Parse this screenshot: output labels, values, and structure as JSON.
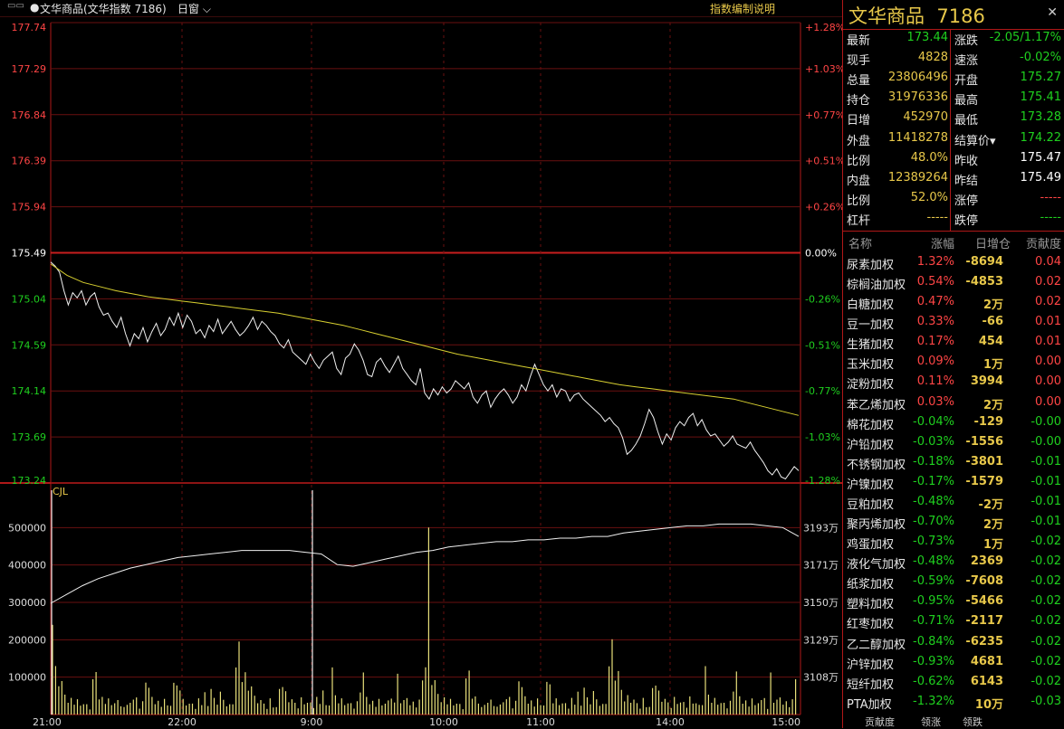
{
  "topbar": {
    "title": "文华商品(文华指数 7186)",
    "period": "日窗",
    "help": "指数编制说明"
  },
  "header": {
    "name": "文华商品",
    "code": "7186"
  },
  "quote_left": [
    {
      "label": "最新",
      "value": "173.44",
      "color": "grn"
    },
    {
      "label": "现手",
      "value": "4828",
      "color": "yel"
    },
    {
      "label": "总量",
      "value": "23806496",
      "color": "yel"
    },
    {
      "label": "持仓",
      "value": "31976336",
      "color": "yel"
    },
    {
      "label": "日增",
      "value": "452970",
      "color": "yel"
    },
    {
      "label": "外盘",
      "value": "11418278",
      "color": "yel"
    },
    {
      "label": "比例",
      "value": "48.0%",
      "color": "yel"
    },
    {
      "label": "内盘",
      "value": "12389264",
      "color": "yel"
    },
    {
      "label": "比例",
      "value": "52.0%",
      "color": "yel"
    },
    {
      "label": "杠杆",
      "value": "-----",
      "color": "yel"
    }
  ],
  "quote_right": [
    {
      "label": "涨跌",
      "value": "-2.05/1.17%",
      "color": "grn"
    },
    {
      "label": "速涨",
      "value": "-0.02%",
      "color": "grn"
    },
    {
      "label": "开盘",
      "value": "175.27",
      "color": "grn"
    },
    {
      "label": "最高",
      "value": "175.41",
      "color": "grn"
    },
    {
      "label": "最低",
      "value": "173.28",
      "color": "grn"
    },
    {
      "label": "结算价▾",
      "value": "174.22",
      "color": "grn"
    },
    {
      "label": "昨收",
      "value": "175.47",
      "color": "wht"
    },
    {
      "label": "昨结",
      "value": "175.49",
      "color": "wht"
    },
    {
      "label": "涨停",
      "value": "-----",
      "color": "red"
    },
    {
      "label": "跌停",
      "value": "-----",
      "color": "grn"
    }
  ],
  "table": {
    "headers": [
      "名称",
      "涨幅",
      "日增仓",
      "贡献度"
    ],
    "rows": [
      {
        "name": "尿素加权",
        "chg": "1.32%",
        "pos": "-8694",
        "contrib": "0.04",
        "chgColor": "red",
        "ctbColor": "red"
      },
      {
        "name": "棕榈油加权",
        "chg": "0.54%",
        "pos": "-4853",
        "contrib": "0.02",
        "chgColor": "red",
        "ctbColor": "red"
      },
      {
        "name": "白糖加权",
        "chg": "0.47%",
        "pos": "2万",
        "contrib": "0.02",
        "chgColor": "red",
        "ctbColor": "red"
      },
      {
        "name": "豆一加权",
        "chg": "0.33%",
        "pos": "-66",
        "contrib": "0.01",
        "chgColor": "red",
        "ctbColor": "red"
      },
      {
        "name": "生猪加权",
        "chg": "0.17%",
        "pos": "454",
        "contrib": "0.01",
        "chgColor": "red",
        "ctbColor": "red"
      },
      {
        "name": "玉米加权",
        "chg": "0.09%",
        "pos": "1万",
        "contrib": "0.00",
        "chgColor": "red",
        "ctbColor": "red"
      },
      {
        "name": "淀粉加权",
        "chg": "0.11%",
        "pos": "3994",
        "contrib": "0.00",
        "chgColor": "red",
        "ctbColor": "red"
      },
      {
        "name": "苯乙烯加权",
        "chg": "0.03%",
        "pos": "2万",
        "contrib": "0.00",
        "chgColor": "red",
        "ctbColor": "red"
      },
      {
        "name": "棉花加权",
        "chg": "-0.04%",
        "pos": "-129",
        "contrib": "-0.00",
        "chgColor": "grn",
        "ctbColor": "grn"
      },
      {
        "name": "沪铅加权",
        "chg": "-0.03%",
        "pos": "-1556",
        "contrib": "-0.00",
        "chgColor": "grn",
        "ctbColor": "grn"
      },
      {
        "name": "不锈钢加权",
        "chg": "-0.18%",
        "pos": "-3801",
        "contrib": "-0.01",
        "chgColor": "grn",
        "ctbColor": "grn"
      },
      {
        "name": "沪镍加权",
        "chg": "-0.17%",
        "pos": "-1579",
        "contrib": "-0.01",
        "chgColor": "grn",
        "ctbColor": "grn"
      },
      {
        "name": "豆粕加权",
        "chg": "-0.48%",
        "pos": "-2万",
        "contrib": "-0.01",
        "chgColor": "grn",
        "ctbColor": "grn"
      },
      {
        "name": "聚丙烯加权",
        "chg": "-0.70%",
        "pos": "2万",
        "contrib": "-0.01",
        "chgColor": "grn",
        "ctbColor": "grn"
      },
      {
        "name": "鸡蛋加权",
        "chg": "-0.73%",
        "pos": "1万",
        "contrib": "-0.02",
        "chgColor": "grn",
        "ctbColor": "grn"
      },
      {
        "name": "液化气加权",
        "chg": "-0.48%",
        "pos": "2369",
        "contrib": "-0.02",
        "chgColor": "grn",
        "ctbColor": "grn"
      },
      {
        "name": "纸浆加权",
        "chg": "-0.59%",
        "pos": "-7608",
        "contrib": "-0.02",
        "chgColor": "grn",
        "ctbColor": "grn"
      },
      {
        "name": "塑料加权",
        "chg": "-0.95%",
        "pos": "-5466",
        "contrib": "-0.02",
        "chgColor": "grn",
        "ctbColor": "grn"
      },
      {
        "name": "红枣加权",
        "chg": "-0.71%",
        "pos": "-2117",
        "contrib": "-0.02",
        "chgColor": "grn",
        "ctbColor": "grn"
      },
      {
        "name": "乙二醇加权",
        "chg": "-0.84%",
        "pos": "-6235",
        "contrib": "-0.02",
        "chgColor": "grn",
        "ctbColor": "grn"
      },
      {
        "name": "沪锌加权",
        "chg": "-0.93%",
        "pos": "4681",
        "contrib": "-0.02",
        "chgColor": "grn",
        "ctbColor": "grn"
      },
      {
        "name": "短纤加权",
        "chg": "-0.62%",
        "pos": "6143",
        "contrib": "-0.02",
        "chgColor": "grn",
        "ctbColor": "grn"
      },
      {
        "name": "PTA加权",
        "chg": "-1.32%",
        "pos": "10万",
        "contrib": "-0.03",
        "chgColor": "grn",
        "ctbColor": "grn"
      }
    ]
  },
  "bottom_tabs": [
    "贡献度",
    "领涨",
    "领跌"
  ],
  "chart_data": {
    "type": "line",
    "price_panel": {
      "y_ticks": [
        177.74,
        177.29,
        176.84,
        176.39,
        175.94,
        175.49,
        175.04,
        174.59,
        174.14,
        173.69,
        173.24
      ],
      "pct_ticks": [
        "+1.28%",
        "+1.03%",
        "+0.77%",
        "+0.51%",
        "+0.26%",
        "0.00%",
        "-0.26%",
        "-0.51%",
        "-0.77%",
        "-1.03%",
        "-1.28%"
      ],
      "ylim": [
        173.24,
        177.74
      ],
      "prev_settle": 175.49,
      "series": [
        {
          "values": [
            175.4,
            175.36,
            175.3,
            175.12,
            174.98,
            175.1,
            175.05,
            175.12,
            174.98,
            175.06,
            175.1,
            174.96,
            174.88,
            174.9,
            174.82,
            174.76,
            174.86,
            174.7,
            174.58,
            174.7,
            174.65,
            174.76,
            174.62,
            174.72,
            174.8,
            174.68,
            174.74,
            174.86,
            174.78,
            174.9,
            174.76,
            174.88,
            174.82,
            174.7,
            174.74,
            174.66,
            174.78,
            174.72,
            174.84,
            174.7,
            174.76,
            174.82,
            174.74,
            174.68,
            174.72,
            174.78,
            174.86,
            174.74,
            174.82,
            174.78,
            174.72,
            174.68,
            174.6,
            174.56,
            174.64,
            174.52,
            174.48,
            174.44,
            174.4,
            174.5,
            174.42,
            174.36,
            174.44,
            174.48,
            174.52,
            174.36,
            174.3,
            174.46,
            174.5,
            174.6,
            174.54,
            174.44,
            174.3,
            174.28,
            174.42,
            174.46,
            174.38,
            174.32,
            174.4,
            174.48,
            174.36,
            174.3,
            174.24,
            174.2,
            174.36,
            174.12,
            174.06,
            174.16,
            174.1,
            174.18,
            174.12,
            174.16,
            174.24,
            174.2,
            174.16,
            174.22,
            174.08,
            174.02,
            174.1,
            174.14,
            173.98,
            174.06,
            174.12,
            174.16,
            174.1,
            174.02,
            174.08,
            174.2,
            174.14,
            174.28,
            174.4,
            174.3,
            174.2,
            174.14,
            174.2,
            174.08,
            174.16,
            174.14,
            174.04,
            174.1,
            174.12,
            174.06,
            174.02,
            173.98,
            173.94,
            173.9,
            173.84,
            173.88,
            173.82,
            173.78,
            173.68,
            173.52,
            173.56,
            173.62,
            173.7,
            173.82,
            173.96,
            173.88,
            173.74,
            173.62,
            173.72,
            173.66,
            173.78,
            173.84,
            173.8,
            173.88,
            173.92,
            173.8,
            173.86,
            173.76,
            173.7,
            173.72,
            173.66,
            173.6,
            173.64,
            173.7,
            173.62,
            173.6,
            173.58,
            173.64,
            173.56,
            173.5,
            173.44,
            173.36,
            173.32,
            173.38,
            173.3,
            173.28,
            173.34,
            173.4,
            173.36
          ]
        },
        {
          "values": [
            175.38,
            175.27,
            175.2,
            175.16,
            175.12,
            175.09,
            175.06,
            175.04,
            175.02,
            175.0,
            174.98,
            174.96,
            174.94,
            174.92,
            174.9,
            174.87,
            174.84,
            174.81,
            174.78,
            174.74,
            174.7,
            174.66,
            174.62,
            174.58,
            174.54,
            174.5,
            174.47,
            174.44,
            174.41,
            174.38,
            174.35,
            174.32,
            174.29,
            174.26,
            174.23,
            174.2,
            174.18,
            174.16,
            174.14,
            174.12,
            174.1,
            174.08,
            174.06,
            174.02,
            173.98,
            173.94,
            173.9
          ]
        }
      ]
    },
    "volume_panel": {
      "label": "CJL",
      "y_ticks": [
        "500000",
        "400000",
        "300000",
        "200000",
        "100000"
      ],
      "ylim": [
        0,
        600000
      ],
      "right_ticks": [
        "3193万",
        "3171万",
        "3150万",
        "3129万",
        "3108万"
      ],
      "oi_curve": [
        3150,
        3155,
        3160,
        3164,
        3167,
        3170,
        3172,
        3174,
        3176,
        3177,
        3178,
        3179,
        3180,
        3180,
        3180,
        3180,
        3179,
        3178,
        3172,
        3171,
        3173,
        3175,
        3177,
        3179,
        3180,
        3182,
        3183,
        3184,
        3185,
        3185,
        3186,
        3186,
        3187,
        3187,
        3188,
        3188,
        3190,
        3191,
        3192,
        3193,
        3194,
        3194,
        3195,
        3195,
        3195,
        3194,
        3193,
        3188
      ],
      "volume_sample": [
        240000,
        150000,
        120000,
        90000,
        70000,
        60000,
        50000,
        40000,
        40000,
        30000,
        50000,
        30000,
        20000,
        90000,
        140000,
        70000,
        50000,
        40000,
        40000,
        30000,
        50000,
        40000,
        30000,
        40000,
        30000,
        50000,
        40000,
        60000,
        30000,
        40000,
        130000,
        70000,
        60000,
        50000,
        40000,
        30000,
        40000,
        30000,
        40000,
        90000,
        110000,
        60000,
        50000,
        40000,
        30000,
        40000,
        30000,
        50000,
        40000,
        60000,
        30000,
        130000,
        50000,
        40000,
        60000,
        50000,
        40000,
        30000,
        40000,
        120000
      ]
    },
    "x_ticks": [
      "21:00",
      "22:00",
      "9:00",
      "10:00",
      "11:00",
      "14:00",
      "15:00"
    ]
  }
}
